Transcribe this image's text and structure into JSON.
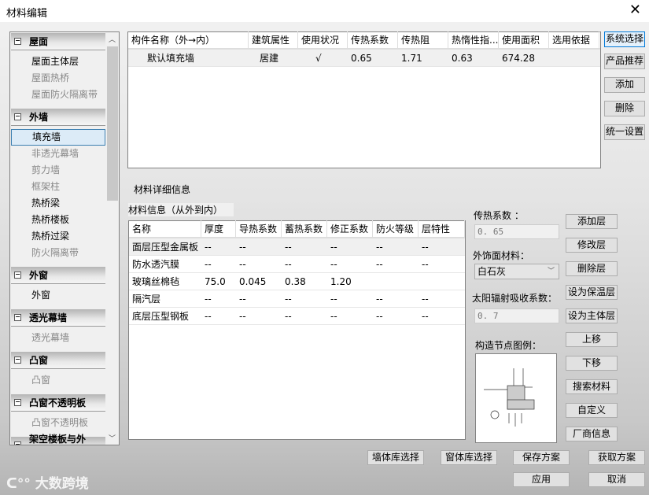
{
  "window": {
    "title": "材料编辑",
    "close": "✕"
  },
  "sidebar": {
    "groups": [
      {
        "label": "屋面",
        "items": [
          {
            "label": "屋面主体层",
            "dim": false
          },
          {
            "label": "屋面热桥",
            "dim": true
          },
          {
            "label": "屋面防火隔离带",
            "dim": true
          }
        ]
      },
      {
        "label": "外墙",
        "items": [
          {
            "label": "填充墙",
            "dim": false,
            "selected": true
          },
          {
            "label": "非透光幕墙",
            "dim": true
          },
          {
            "label": "剪力墙",
            "dim": true
          },
          {
            "label": "框架柱",
            "dim": true
          },
          {
            "label": "热桥梁",
            "dim": false
          },
          {
            "label": "热桥楼板",
            "dim": false
          },
          {
            "label": "热桥过梁",
            "dim": false
          },
          {
            "label": "防火隔离带",
            "dim": true
          }
        ]
      },
      {
        "label": "外窗",
        "items": [
          {
            "label": "外窗",
            "dim": false
          }
        ]
      },
      {
        "label": "透光幕墙",
        "items": [
          {
            "label": "透光幕墙",
            "dim": true
          }
        ]
      },
      {
        "label": "凸窗",
        "items": [
          {
            "label": "凸窗",
            "dim": true
          }
        ]
      },
      {
        "label": "凸窗不透明板",
        "items": [
          {
            "label": "凸窗不透明板",
            "dim": true
          }
        ]
      },
      {
        "label": "架空楼板与外挑...",
        "items": []
      }
    ]
  },
  "components": {
    "columns": [
      "构件名称（外→内）",
      "建筑属性",
      "使用状况",
      "传热系数",
      "传热阻",
      "热惰性指...",
      "使用面积",
      "选用依据"
    ],
    "rows": [
      [
        "默认填充墙",
        "居建",
        "√",
        "0.65",
        "1.71",
        "0.63",
        "674.28",
        ""
      ]
    ]
  },
  "side_buttons": [
    "系统选择",
    "产品推荐",
    "添加",
    "删除",
    "统一设置"
  ],
  "detail": {
    "title": "材料详细信息",
    "subtitle": "材料信息（从外到内）",
    "columns": [
      "名称",
      "厚度",
      "导热系数",
      "蓄热系数",
      "修正系数",
      "防火等级",
      "层特性"
    ],
    "rows": [
      [
        "面层压型金属板",
        "--",
        "--",
        "--",
        "--",
        "--",
        "--"
      ],
      [
        "防水透汽膜",
        "--",
        "--",
        "--",
        "--",
        "--",
        "--"
      ],
      [
        "玻璃丝棉毡",
        "75.0",
        "0.045",
        "0.38",
        "1.20",
        "",
        ""
      ],
      [
        "隔汽层",
        "--",
        "--",
        "--",
        "--",
        "--",
        "--"
      ],
      [
        "底层压型钢板",
        "--",
        "--",
        "--",
        "--",
        "--",
        "--"
      ]
    ]
  },
  "props": {
    "u_label": "传热系数 ：",
    "u_value": "0. 65",
    "finish_label": "外饰面材料：",
    "finish_value": "白石灰",
    "solar_label": "太阳辐射吸收系数：",
    "solar_value": "0. 7",
    "node_label": "构造节点图例："
  },
  "layer_buttons": [
    "添加层",
    "修改层",
    "删除层",
    "设为保温层",
    "设为主体层",
    "上移",
    "下移",
    "搜索材料",
    "自定义",
    "厂商信息"
  ],
  "bottom": {
    "wall_lib": "墙体库选择",
    "window_lib": "窗体库选择",
    "save": "保存方案",
    "load": "获取方案",
    "apply": "应用",
    "cancel": "取消"
  },
  "watermark": "大数跨境"
}
